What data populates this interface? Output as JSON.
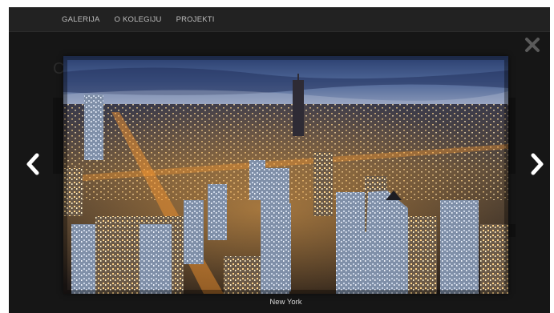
{
  "navbar": {
    "items": [
      {
        "label": "GALERIJA"
      },
      {
        "label": "O KOLEGIJU"
      },
      {
        "label": "PROJEKTI"
      }
    ]
  },
  "background_page": {
    "heading_initial": "C"
  },
  "lightbox": {
    "caption": "New York",
    "image_description_icon": "city-skyline-photo",
    "close_icon": "close-icon",
    "prev_icon": "chevron-left-icon",
    "next_icon": "chevron-right-icon"
  },
  "colors": {
    "navbar_bg": "#222222",
    "overlay_bg": "#1b1b1b",
    "nav_text": "#bdbdbd",
    "caption_text": "#d8d8d8"
  }
}
